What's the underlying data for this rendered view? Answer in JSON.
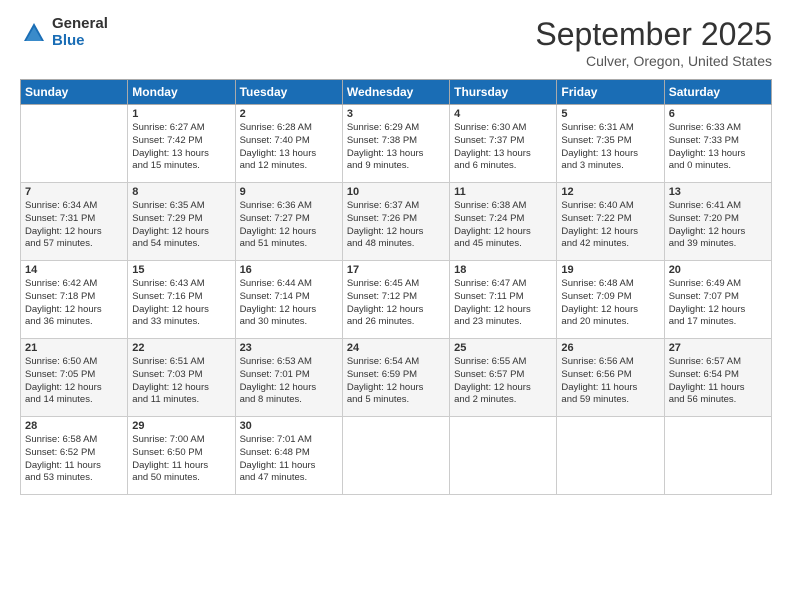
{
  "header": {
    "logo_general": "General",
    "logo_blue": "Blue",
    "month_title": "September 2025",
    "location": "Culver, Oregon, United States"
  },
  "days_of_week": [
    "Sunday",
    "Monday",
    "Tuesday",
    "Wednesday",
    "Thursday",
    "Friday",
    "Saturday"
  ],
  "weeks": [
    [
      {
        "day": "",
        "info": ""
      },
      {
        "day": "1",
        "info": "Sunrise: 6:27 AM\nSunset: 7:42 PM\nDaylight: 13 hours\nand 15 minutes."
      },
      {
        "day": "2",
        "info": "Sunrise: 6:28 AM\nSunset: 7:40 PM\nDaylight: 13 hours\nand 12 minutes."
      },
      {
        "day": "3",
        "info": "Sunrise: 6:29 AM\nSunset: 7:38 PM\nDaylight: 13 hours\nand 9 minutes."
      },
      {
        "day": "4",
        "info": "Sunrise: 6:30 AM\nSunset: 7:37 PM\nDaylight: 13 hours\nand 6 minutes."
      },
      {
        "day": "5",
        "info": "Sunrise: 6:31 AM\nSunset: 7:35 PM\nDaylight: 13 hours\nand 3 minutes."
      },
      {
        "day": "6",
        "info": "Sunrise: 6:33 AM\nSunset: 7:33 PM\nDaylight: 13 hours\nand 0 minutes."
      }
    ],
    [
      {
        "day": "7",
        "info": "Sunrise: 6:34 AM\nSunset: 7:31 PM\nDaylight: 12 hours\nand 57 minutes."
      },
      {
        "day": "8",
        "info": "Sunrise: 6:35 AM\nSunset: 7:29 PM\nDaylight: 12 hours\nand 54 minutes."
      },
      {
        "day": "9",
        "info": "Sunrise: 6:36 AM\nSunset: 7:27 PM\nDaylight: 12 hours\nand 51 minutes."
      },
      {
        "day": "10",
        "info": "Sunrise: 6:37 AM\nSunset: 7:26 PM\nDaylight: 12 hours\nand 48 minutes."
      },
      {
        "day": "11",
        "info": "Sunrise: 6:38 AM\nSunset: 7:24 PM\nDaylight: 12 hours\nand 45 minutes."
      },
      {
        "day": "12",
        "info": "Sunrise: 6:40 AM\nSunset: 7:22 PM\nDaylight: 12 hours\nand 42 minutes."
      },
      {
        "day": "13",
        "info": "Sunrise: 6:41 AM\nSunset: 7:20 PM\nDaylight: 12 hours\nand 39 minutes."
      }
    ],
    [
      {
        "day": "14",
        "info": "Sunrise: 6:42 AM\nSunset: 7:18 PM\nDaylight: 12 hours\nand 36 minutes."
      },
      {
        "day": "15",
        "info": "Sunrise: 6:43 AM\nSunset: 7:16 PM\nDaylight: 12 hours\nand 33 minutes."
      },
      {
        "day": "16",
        "info": "Sunrise: 6:44 AM\nSunset: 7:14 PM\nDaylight: 12 hours\nand 30 minutes."
      },
      {
        "day": "17",
        "info": "Sunrise: 6:45 AM\nSunset: 7:12 PM\nDaylight: 12 hours\nand 26 minutes."
      },
      {
        "day": "18",
        "info": "Sunrise: 6:47 AM\nSunset: 7:11 PM\nDaylight: 12 hours\nand 23 minutes."
      },
      {
        "day": "19",
        "info": "Sunrise: 6:48 AM\nSunset: 7:09 PM\nDaylight: 12 hours\nand 20 minutes."
      },
      {
        "day": "20",
        "info": "Sunrise: 6:49 AM\nSunset: 7:07 PM\nDaylight: 12 hours\nand 17 minutes."
      }
    ],
    [
      {
        "day": "21",
        "info": "Sunrise: 6:50 AM\nSunset: 7:05 PM\nDaylight: 12 hours\nand 14 minutes."
      },
      {
        "day": "22",
        "info": "Sunrise: 6:51 AM\nSunset: 7:03 PM\nDaylight: 12 hours\nand 11 minutes."
      },
      {
        "day": "23",
        "info": "Sunrise: 6:53 AM\nSunset: 7:01 PM\nDaylight: 12 hours\nand 8 minutes."
      },
      {
        "day": "24",
        "info": "Sunrise: 6:54 AM\nSunset: 6:59 PM\nDaylight: 12 hours\nand 5 minutes."
      },
      {
        "day": "25",
        "info": "Sunrise: 6:55 AM\nSunset: 6:57 PM\nDaylight: 12 hours\nand 2 minutes."
      },
      {
        "day": "26",
        "info": "Sunrise: 6:56 AM\nSunset: 6:56 PM\nDaylight: 11 hours\nand 59 minutes."
      },
      {
        "day": "27",
        "info": "Sunrise: 6:57 AM\nSunset: 6:54 PM\nDaylight: 11 hours\nand 56 minutes."
      }
    ],
    [
      {
        "day": "28",
        "info": "Sunrise: 6:58 AM\nSunset: 6:52 PM\nDaylight: 11 hours\nand 53 minutes."
      },
      {
        "day": "29",
        "info": "Sunrise: 7:00 AM\nSunset: 6:50 PM\nDaylight: 11 hours\nand 50 minutes."
      },
      {
        "day": "30",
        "info": "Sunrise: 7:01 AM\nSunset: 6:48 PM\nDaylight: 11 hours\nand 47 minutes."
      },
      {
        "day": "",
        "info": ""
      },
      {
        "day": "",
        "info": ""
      },
      {
        "day": "",
        "info": ""
      },
      {
        "day": "",
        "info": ""
      }
    ]
  ]
}
